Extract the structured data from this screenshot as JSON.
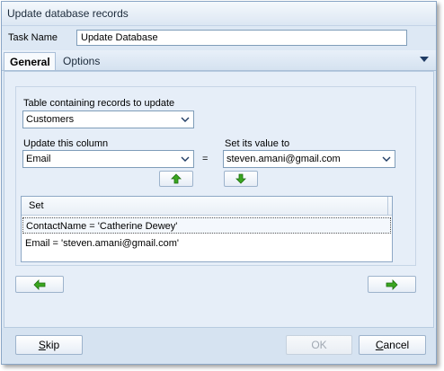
{
  "window": {
    "title": "Update database records"
  },
  "task": {
    "label": "Task Name",
    "value": "Update Database"
  },
  "tabs": [
    {
      "label": "General",
      "active": true
    },
    {
      "label": "Options",
      "active": false
    }
  ],
  "general": {
    "table_label": "Table containing records to update",
    "table_value": "Customers",
    "column_label": "Update this column",
    "column_value": "Email",
    "equals": "=",
    "set_value_label": "Set its value to",
    "set_value_value": "steven.amani@gmail.com",
    "grid": {
      "header": "Set",
      "rows": [
        {
          "text": "ContactName = 'Catherine Dewey'",
          "selected": true
        },
        {
          "text": "Email = 'steven.amani@gmail.com'",
          "selected": false
        }
      ]
    }
  },
  "footer": {
    "skip_label": "kip",
    "skip_mnemonic": "S",
    "ok_label": "OK",
    "cancel_label": "ancel",
    "cancel_mnemonic": "C"
  },
  "colors": {
    "window_bg": "#dde8f4",
    "arrow_green": "#3aa620",
    "chevron": "#1f3b63"
  },
  "icons": {
    "move_up": "up-arrow-icon",
    "move_down": "down-arrow-icon",
    "prev": "left-arrow-icon",
    "next": "right-arrow-icon",
    "dropdown": "chevron-down-icon",
    "tab_menu": "tab-menu-triangle-icon"
  }
}
